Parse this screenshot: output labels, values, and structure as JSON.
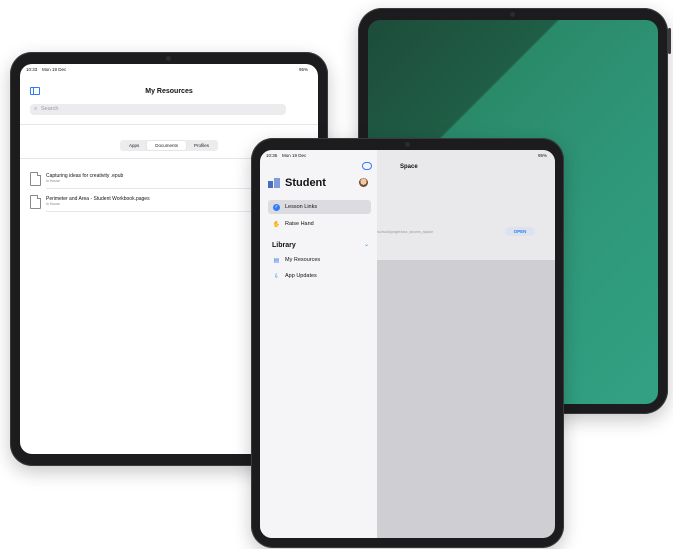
{
  "left_ipad": {
    "status_time": "10:33",
    "status_date": "Mon 19 Dec",
    "status_battery": "95%",
    "title": "My Resources",
    "search_placeholder": "Search",
    "segments": [
      "Apps",
      "Documents",
      "Profiles"
    ],
    "selected_segment": "Documents",
    "documents": [
      {
        "name": "Capturing ideas for creativity .epub",
        "sub": "In House"
      },
      {
        "name": "Perimeter and Area - Student Workbook.pages",
        "sub": "In House"
      }
    ]
  },
  "front_ipad": {
    "status_time": "10:35",
    "status_date": "Mon 19 Dec",
    "status_battery": "95%",
    "app_name": "Student",
    "menu": [
      {
        "label": "Lesson Links",
        "icon": "checkmark-circle-icon",
        "selected": true
      },
      {
        "label": "Raise Hand",
        "icon": "hand-icon",
        "selected": false
      }
    ],
    "library_title": "Library",
    "library": [
      {
        "label": "My Resources",
        "icon": "resources-icon"
      },
      {
        "label": "App Updates",
        "icon": "updates-icon"
      }
    ],
    "detail_title": "Space",
    "link_url": "/school/jungle/sea_shores_space",
    "open_label": "OPEN"
  },
  "colors": {
    "accent": "#2f7cf6",
    "wallpaper_dark": "#1d4c3b",
    "wallpaper_light": "#32a183"
  }
}
